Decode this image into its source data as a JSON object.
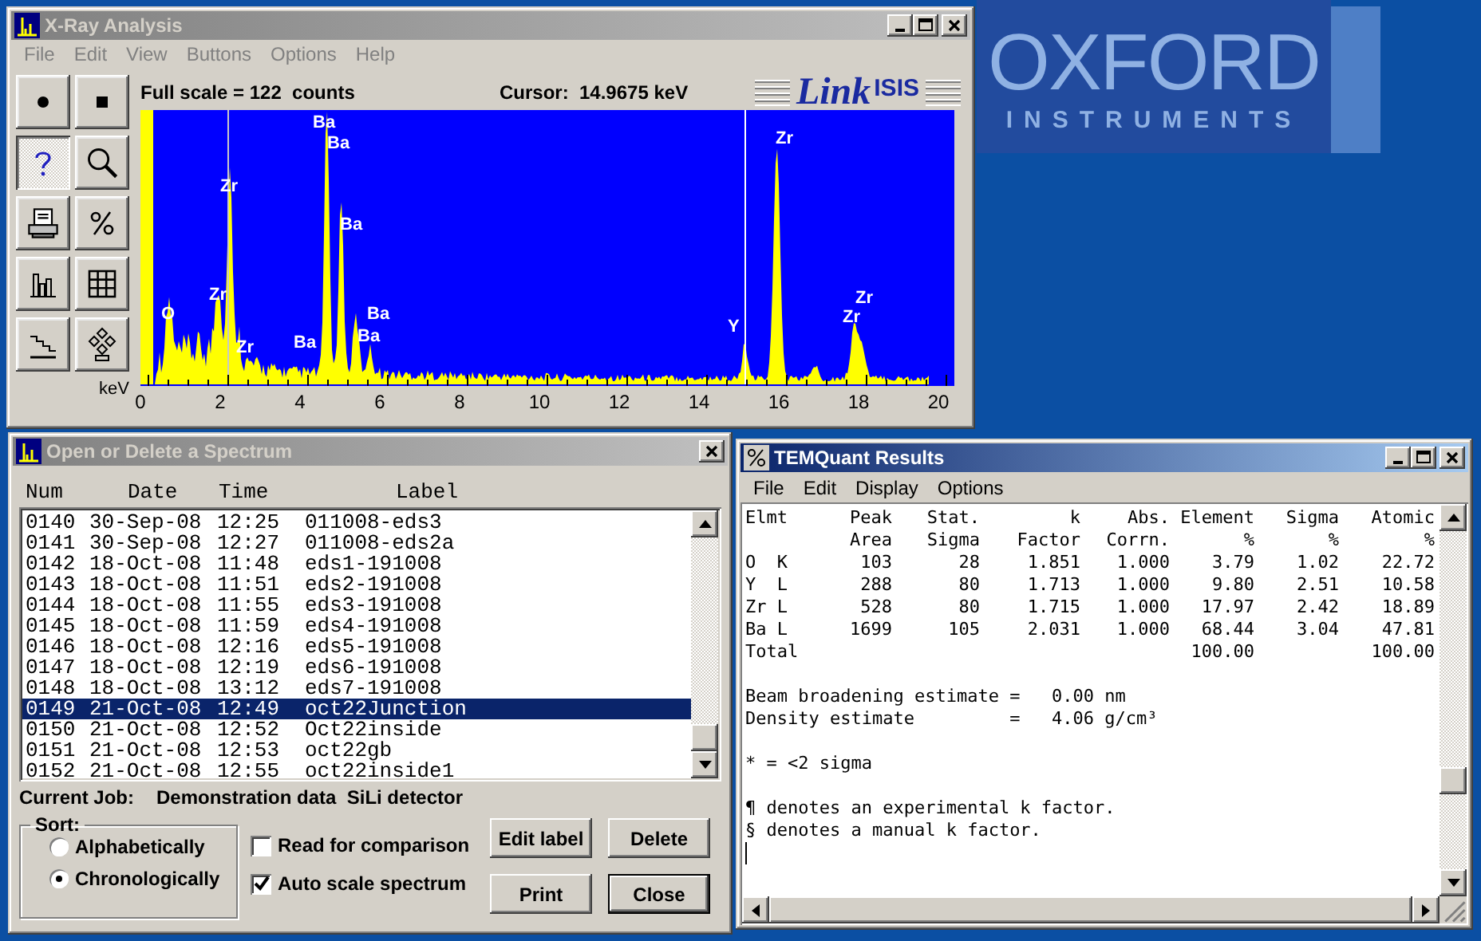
{
  "logo": {
    "wordmark": "OXFORD",
    "subtitle": "INSTRUMENTS"
  },
  "xray_window": {
    "title": "X-Ray Analysis",
    "active": false,
    "menu": [
      {
        "label": "File",
        "disabled": true
      },
      {
        "label": "Edit",
        "disabled": true
      },
      {
        "label": "View",
        "disabled": true
      },
      {
        "label": "Buttons",
        "disabled": true
      },
      {
        "label": "Options",
        "disabled": true
      },
      {
        "label": "Help",
        "disabled": true
      }
    ],
    "tools": [
      {
        "kind": "record",
        "selected": false
      },
      {
        "kind": "stop",
        "selected": false
      },
      {
        "kind": "help",
        "selected": true
      },
      {
        "kind": "zoom",
        "selected": false
      },
      {
        "kind": "print",
        "selected": false
      },
      {
        "kind": "percent",
        "selected": false
      },
      {
        "kind": "histogram",
        "selected": false
      },
      {
        "kind": "grid",
        "selected": false
      },
      {
        "kind": "steps",
        "selected": false
      },
      {
        "kind": "diamonds",
        "selected": false
      }
    ],
    "full_scale": "Full scale = 122  counts",
    "cursor": "Cursor:  14.9675 keV",
    "brand": {
      "link": "Link",
      "isis": "ISIS"
    },
    "spectrum": {
      "x_unit": "keV",
      "x_ticks": [
        "0",
        "2",
        "4",
        "6",
        "8",
        "10",
        "12",
        "14",
        "16",
        "18",
        "20"
      ],
      "peak_labels": [
        "Ba",
        "Ba",
        "Zr",
        "Zr",
        "Ba",
        "Zr",
        "Zr",
        "O",
        "Zr",
        "Ba",
        "Ba",
        "Ba",
        "Y",
        "Zr"
      ]
    }
  },
  "spectrum_dialog": {
    "title": "Open or Delete a Spectrum",
    "active": false,
    "columns": [
      "Num",
      "Date",
      "Time",
      "Label"
    ],
    "rows": [
      {
        "num": "0140",
        "date": "30-Sep-08",
        "time": "12:25",
        "label": "011008-eds3",
        "selected": false
      },
      {
        "num": "0141",
        "date": "30-Sep-08",
        "time": "12:27",
        "label": "011008-eds2a",
        "selected": false
      },
      {
        "num": "0142",
        "date": "18-Oct-08",
        "time": "11:48",
        "label": "eds1-191008",
        "selected": false
      },
      {
        "num": "0143",
        "date": "18-Oct-08",
        "time": "11:51",
        "label": "eds2-191008",
        "selected": false
      },
      {
        "num": "0144",
        "date": "18-Oct-08",
        "time": "11:55",
        "label": "eds3-191008",
        "selected": false
      },
      {
        "num": "0145",
        "date": "18-Oct-08",
        "time": "11:59",
        "label": "eds4-191008",
        "selected": false
      },
      {
        "num": "0146",
        "date": "18-Oct-08",
        "time": "12:16",
        "label": "eds5-191008",
        "selected": false
      },
      {
        "num": "0147",
        "date": "18-Oct-08",
        "time": "12:19",
        "label": "eds6-191008",
        "selected": false
      },
      {
        "num": "0148",
        "date": "18-Oct-08",
        "time": "13:12",
        "label": "eds7-191008",
        "selected": false
      },
      {
        "num": "0149",
        "date": "21-Oct-08",
        "time": "12:49",
        "label": "oct22Junction",
        "selected": true
      },
      {
        "num": "0150",
        "date": "21-Oct-08",
        "time": "12:52",
        "label": "Oct22inside",
        "selected": false
      },
      {
        "num": "0151",
        "date": "21-Oct-08",
        "time": "12:53",
        "label": "oct22gb",
        "selected": false
      },
      {
        "num": "0152",
        "date": "21-Oct-08",
        "time": "12:55",
        "label": "oct22inside1",
        "selected": false
      }
    ],
    "current_job": {
      "label": "Current Job:",
      "value": "Demonstration data  SiLi detector"
    },
    "sort": {
      "legend": "Sort:",
      "options": [
        {
          "label": "Alphabetically",
          "selected": false
        },
        {
          "label": "Chronologically",
          "selected": true
        }
      ]
    },
    "checkboxes": [
      {
        "label": "Read for comparison",
        "checked": false
      },
      {
        "label": "Auto scale spectrum",
        "checked": true
      }
    ],
    "buttons": [
      {
        "label": "Edit label",
        "default": false
      },
      {
        "label": "Delete",
        "default": false
      },
      {
        "label": "Print",
        "default": false
      },
      {
        "label": "Close",
        "default": true
      }
    ]
  },
  "results_window": {
    "title": "TEMQuant Results",
    "active": true,
    "menu": [
      "File",
      "Edit",
      "Display",
      "Options"
    ],
    "columns": [
      {
        "top": "Elmt"
      },
      {
        "top": "Peak",
        "bottom": "Area"
      },
      {
        "top": "Stat.",
        "bottom": "Sigma"
      },
      {
        "top": "k",
        "bottom": "Factor"
      },
      {
        "top": "Abs.",
        "bottom": "Corrn."
      },
      {
        "top": "Element",
        "bottom": "%"
      },
      {
        "top": "Sigma",
        "bottom": "%"
      },
      {
        "top": "Atomic",
        "bottom": "%"
      }
    ],
    "rows": [
      [
        "O  K",
        "103",
        "28",
        "1.851",
        "1.000",
        "3.79",
        "1.02",
        "22.72"
      ],
      [
        "Y  L",
        "288",
        "80",
        "1.713",
        "1.000",
        "9.80",
        "2.51",
        "10.58"
      ],
      [
        "Zr L",
        "528",
        "80",
        "1.715",
        "1.000",
        "17.97",
        "2.42",
        "18.89"
      ],
      [
        "Ba L",
        "1699",
        "105",
        "2.031",
        "1.000",
        "68.44",
        "3.04",
        "47.81"
      ]
    ],
    "total": {
      "label": "Total",
      "element": "100.00",
      "atomic": "100.00"
    },
    "estimates": [
      "Beam broadening estimate =   0.00 nm",
      "Density estimate         =   4.06 g/cm³"
    ],
    "notes": [
      "* = <2 sigma"
    ],
    "legend": [
      "¶ denotes an experimental k factor.",
      "§ denotes a manual k factor."
    ]
  }
}
